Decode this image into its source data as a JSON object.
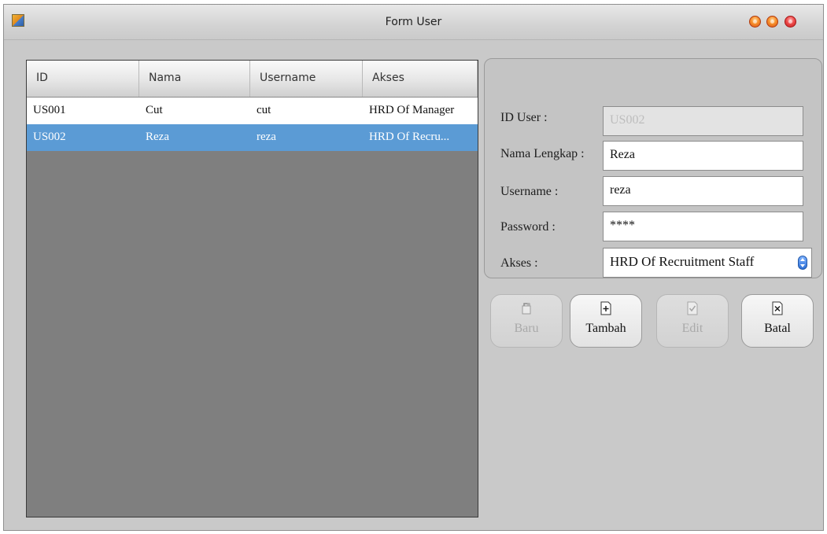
{
  "window": {
    "title": "Form User"
  },
  "grid": {
    "columns": [
      "ID",
      "Nama",
      "Username",
      "Akses"
    ],
    "rows": [
      {
        "id": "US001",
        "nama": "Cut",
        "username": "cut",
        "akses": "HRD Of Manager"
      },
      {
        "id": "US002",
        "nama": "Reza",
        "username": "reza",
        "akses": "HRD Of Recru..."
      }
    ],
    "selected_row": 1
  },
  "form": {
    "id_label": "ID User :",
    "id_value": "US002",
    "nama_label": "Nama Lengkap :",
    "nama_value": "Reza",
    "username_label": "Username :",
    "username_value": "reza",
    "password_label": "Password :",
    "password_value": "****",
    "akses_label": "Akses :",
    "akses_value": "HRD Of Recruitment Staff"
  },
  "buttons": {
    "baru": "Baru",
    "tambah": "Tambah",
    "edit": "Edit",
    "batal": "Batal"
  },
  "colors": {
    "selection": "#5b9bd5",
    "grid_background": "#7f7f7f",
    "window_background": "#c9c9c9"
  },
  "icons": [
    "app-icon",
    "new-file-icon",
    "add-file-icon",
    "edit-file-icon",
    "cancel-file-icon"
  ]
}
